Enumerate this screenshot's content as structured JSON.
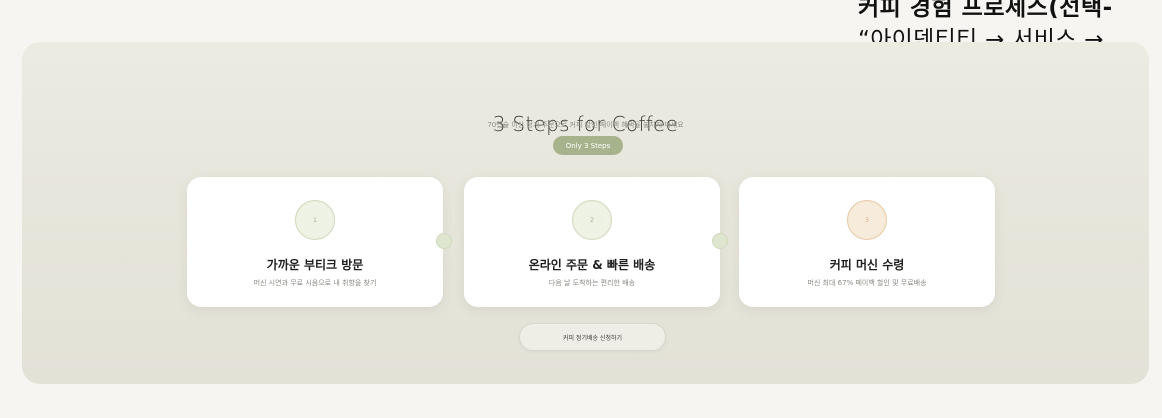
{
  "caption": {
    "title": "커피 경험 프로세스(선택-",
    "line": "“아이덴티티 → 서비스 →"
  },
  "hero": {
    "title": "3 Steps for Coffee",
    "subtitle": "70캡슐 이상 정기 주문으로 커피 할인 페이백 혜택을 놓치지 마세요",
    "pill": "Only 3 Steps"
  },
  "steps": [
    {
      "number": "1",
      "title": "가까운 부티크 방문",
      "description": "머신 시연과 무료 시음으로 내 취향을 찾기"
    },
    {
      "number": "2",
      "title": "온라인 주문 & 빠른 배송",
      "description": "다음 날 도착하는 편리한 배송"
    },
    {
      "number": "3",
      "title": "커피 머신 수령",
      "description": "머신 최대 67% 페이백 할인 및 무료배송"
    }
  ],
  "cta": {
    "label": "커피 정기배송 신청하기"
  },
  "colors": {
    "accent_green": "#a7b38c",
    "accent_warm": "#e8c9a4",
    "panel_bg": "#e7e6dc"
  },
  "icons": [
    "step-number-circle-icon",
    "connector-dot-icon"
  ]
}
